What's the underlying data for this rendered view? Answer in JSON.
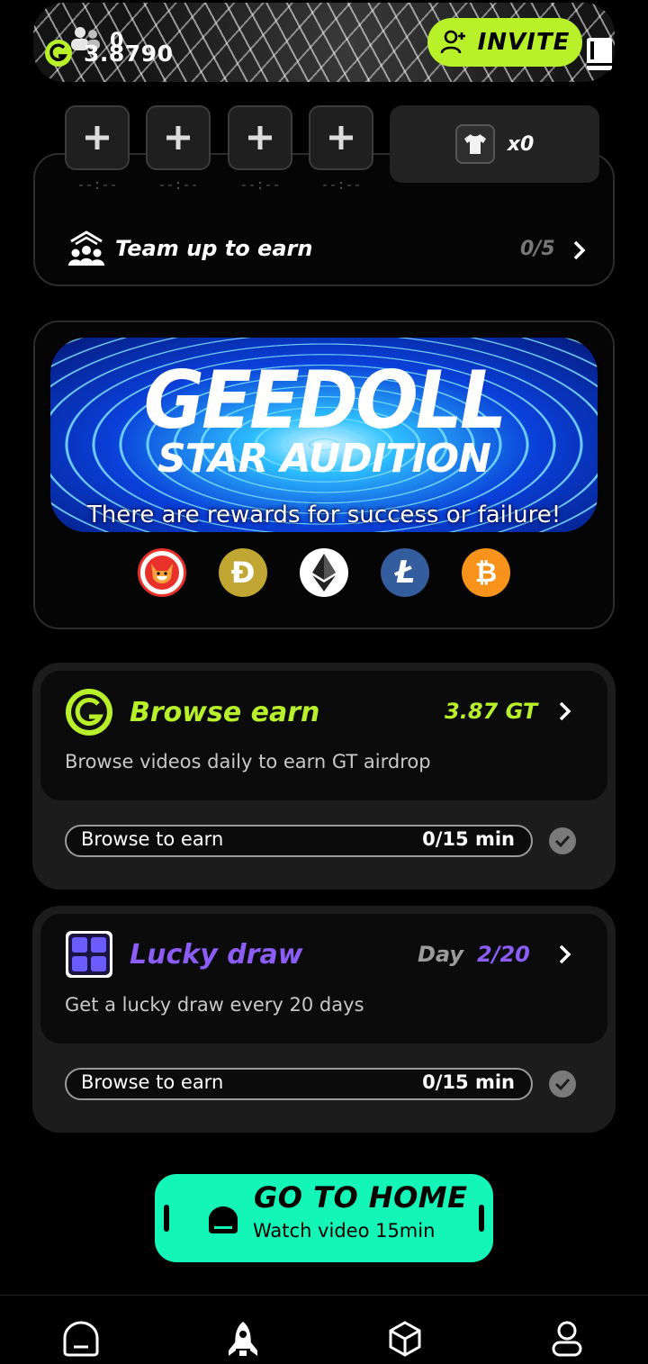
{
  "header": {
    "team_count": "0",
    "balance": "3.8790",
    "invite_label": "INVITE"
  },
  "team": {
    "slots": [
      {
        "time": "--:--"
      },
      {
        "time": "--:--"
      },
      {
        "time": "--:--"
      },
      {
        "time": "--:--"
      }
    ],
    "shirt_count": "x0",
    "label": "Team up to earn",
    "progress": "0/5"
  },
  "banner": {
    "title": "GEEDOLL",
    "subtitle": "STAR AUDITION",
    "tagline": "There are rewards for success or failure!",
    "coins": [
      {
        "name": "shiba-inu",
        "color": "#e8312a"
      },
      {
        "name": "dogecoin",
        "color": "#c2a633"
      },
      {
        "name": "ethereum",
        "color": "#ffffff"
      },
      {
        "name": "litecoin",
        "color": "#345d9d"
      },
      {
        "name": "bitcoin",
        "color": "#f7931a"
      }
    ]
  },
  "browse": {
    "title": "Browse earn",
    "value": "3.87 GT",
    "description": "Browse videos daily to earn GT airdrop",
    "progress_label": "Browse to earn",
    "progress_value": "0/15 min",
    "accent": "#b8f02a"
  },
  "lucky": {
    "title": "Lucky draw",
    "day_label": "Day",
    "day_value": "2/20",
    "description": "Get a lucky draw every 20 days",
    "progress_label": "Browse to earn",
    "progress_value": "0/15 min",
    "accent": "#8b5cf6"
  },
  "go_home": {
    "title": "GO TO HOME",
    "subtitle": "Watch video 15min"
  },
  "nav": {
    "items": [
      "home-icon",
      "rocket-icon",
      "cube-icon",
      "profile-icon"
    ]
  }
}
